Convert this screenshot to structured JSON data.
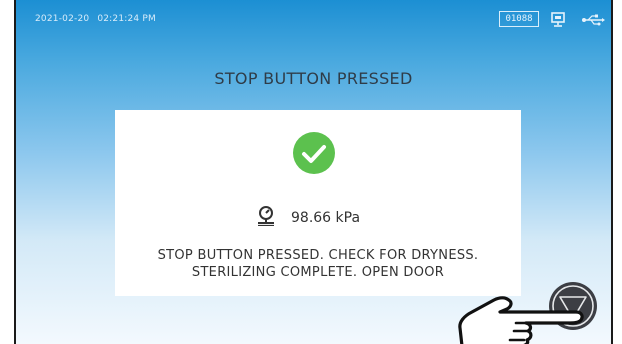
{
  "status_bar": {
    "date": "2021-02-20",
    "time": "02:21:24 PM",
    "counter": "01088",
    "icons": [
      "network-icon",
      "usb-icon"
    ]
  },
  "heading": "STOP BUTTON PRESSED",
  "dialog": {
    "status_icon": "success-check-icon",
    "pressure_icon": "pressure-gauge-icon",
    "pressure_value": "98.66 kPa",
    "message_line1": "STOP BUTTON PRESSED. CHECK FOR DRYNESS.",
    "message_line2": "STERILIZING COMPLETE. OPEN DOOR"
  },
  "controls": {
    "stop_button_icon": "stop-triangle-icon",
    "pointer_icon": "pointing-hand-icon"
  },
  "colors": {
    "gradient_top": "#1c8fd3",
    "gradient_bottom": "#f3f9fe",
    "success_green": "#5cc14e",
    "stop_button": "#3c3e44"
  }
}
